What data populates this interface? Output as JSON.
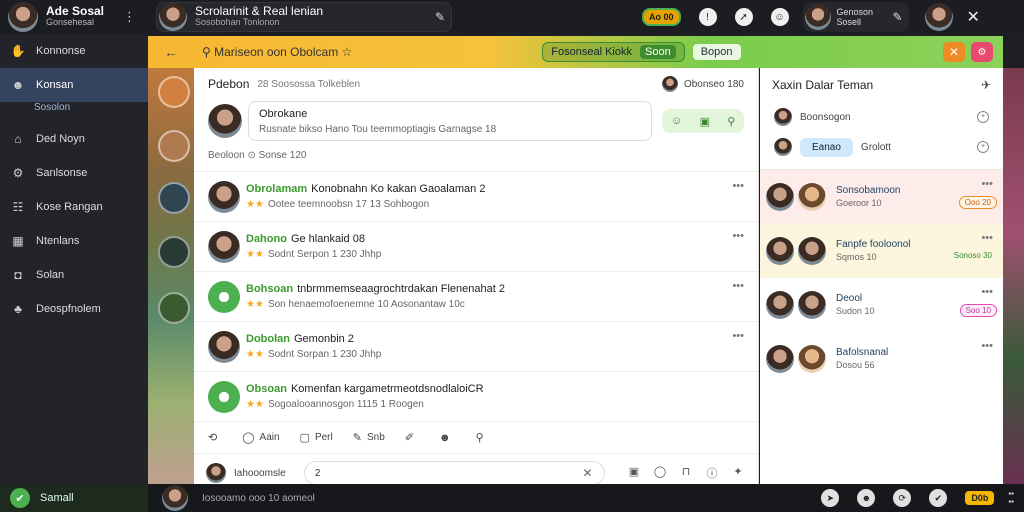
{
  "topbar": {
    "brand_title": "Ade Sosal",
    "brand_sub": "Gonsehesal",
    "kebab": "⋮",
    "title": "Scrolarinit & Real lenian",
    "title_sub": "Sosobohan Tonlonon",
    "badge": "Ao 00",
    "user_line1": "Genoson",
    "user_line2": "Sosell"
  },
  "sidebar": {
    "items": [
      {
        "label": "Konnonse",
        "icon": "hand"
      },
      {
        "label": "Konsan",
        "icon": "user",
        "sub": "Sosolon"
      },
      {
        "label": "Ded Noyn",
        "icon": "home"
      },
      {
        "label": "Sanlsonse",
        "icon": "gear"
      },
      {
        "label": "Kose Rangan",
        "icon": "users"
      },
      {
        "label": "Ntenlans",
        "icon": "grid"
      },
      {
        "label": "Solan",
        "icon": "camera"
      },
      {
        "label": "Deospfnolem",
        "icon": "gamepad"
      }
    ]
  },
  "header": {
    "back": "←",
    "search_text": "Mariseon oon Obolcam",
    "pill": "Fosonseal Kiokk",
    "pill_inner": "Soon",
    "pill2": "Bopon"
  },
  "feed": {
    "title": "Pdebon",
    "subtitle": "28 Soosossa Tolkeblen",
    "head_right": "Obonseo 180",
    "composer_name": "Obrokane",
    "composer_prompt": "Rusnate bikso Hano Tou teemmoptiagis Garnagse 18",
    "meta": "Beoloon  ⊙ Sonse 120",
    "posts": [
      {
        "name": "Obrolamam",
        "text": "Konobnahn Ko kakan Gaoalaman 2",
        "sub": "Ootee teemnoobsn 17 13 Sohbogon"
      },
      {
        "name": "Dahono",
        "text": "Ge hlankaid 08",
        "sub": "Sodnt Serpon 1 230 Jhhp"
      },
      {
        "name": "Bohsoan",
        "text": "tnbrmmemseaagrochtrdakan Flenenahat 2",
        "sub": "Son henaemofoenemne 10 Aosonantaw 10c"
      },
      {
        "name": "Dobolan",
        "text": "Gemonbin 2",
        "sub": "Sodnt Sorpan 1 230 Jhhp"
      },
      {
        "name": "Obsoan",
        "text": "Komenfan kargametrmeotdsnodlaloiCR",
        "sub": "Sogoalooannosgon 1115 1 Roogen"
      }
    ],
    "actions": [
      "Aain",
      "Perl",
      "Snb"
    ],
    "reply_label": "Iahooomsle",
    "reply_value": "2"
  },
  "friends": {
    "title": "Xaxin Dalar Teman",
    "row1": "Boonsogon",
    "chip": "Eanao",
    "row2": "Grolott",
    "items": [
      {
        "name": "Sonsobamoon",
        "sub": "Goeroor 10",
        "tag": "Ooo 20"
      },
      {
        "name": "Fanpfe fooloonol",
        "sub": "Sqmos 10",
        "tag": "Sonoso 30"
      },
      {
        "name": "Deool",
        "sub": "Sudon 10",
        "tag": "Soo 10"
      },
      {
        "name": "Bafolsnanal",
        "sub": "Dosou 56",
        "tag": ""
      }
    ]
  },
  "bottombar": {
    "status": "Samall",
    "text": "Iosooamo ooo 10 aomeol",
    "badge": "D0b"
  },
  "colors": {
    "accent_green": "#4caf50",
    "header_yellow": "#f7b733",
    "header_green": "#8bd15a",
    "sidebar_active": "#34445e"
  }
}
